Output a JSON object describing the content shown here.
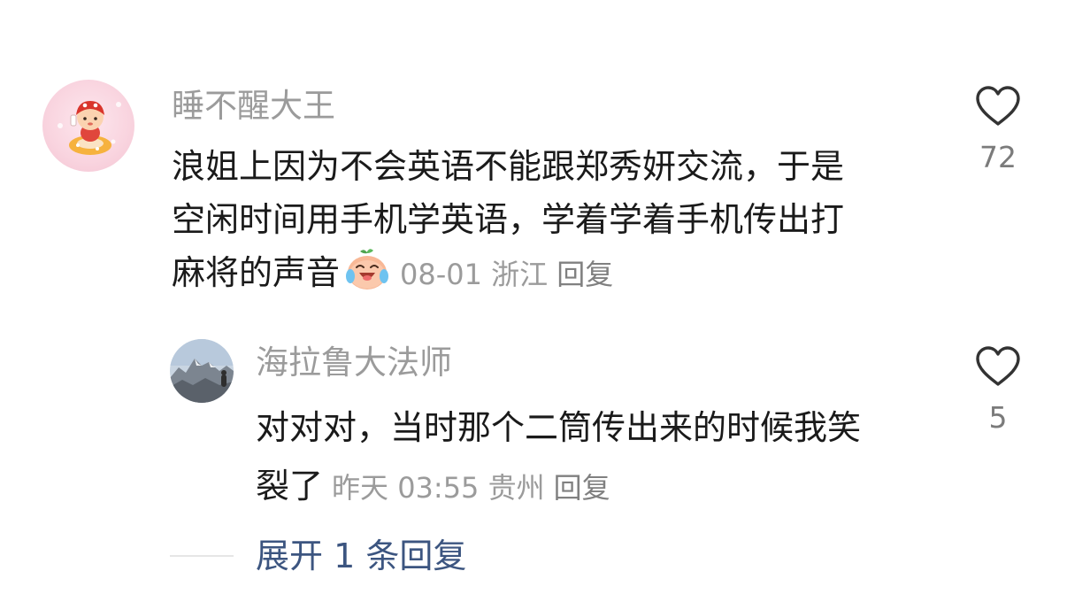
{
  "comment": {
    "username": "睡不醒大王",
    "text_lines": [
      "浪姐上因为不会英语不能跟郑秀妍交流，于是",
      "空闲时间用手机学英语，学着学着手机传出打",
      "麻将的声音"
    ],
    "emoji": "crying-laughing-peach-emoji",
    "date": "08-01",
    "location": "浙江",
    "reply_label": "回复",
    "likes": "72"
  },
  "reply": {
    "username": "海拉鲁大法师",
    "text_lines": [
      "对对对，当时那个二筒传出来的时候我笑",
      "裂了"
    ],
    "date": "昨天 03:55",
    "location": "贵州",
    "reply_label": "回复",
    "likes": "5"
  },
  "expand": {
    "label": "展开 1 条回复"
  },
  "colors": {
    "username": "#9b9b9b",
    "text": "#1a1a1a",
    "meta": "#9b9b9b",
    "link": "#3c5580"
  }
}
